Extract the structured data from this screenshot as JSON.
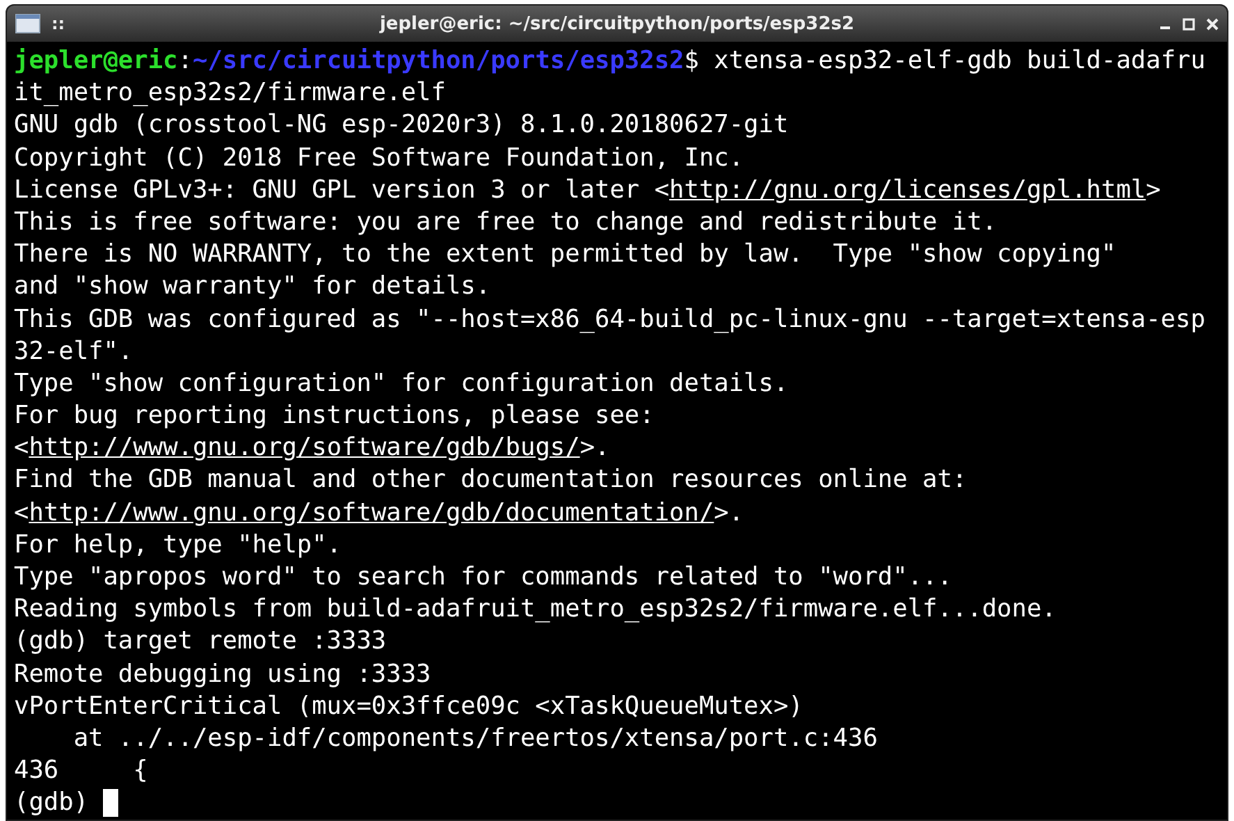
{
  "window": {
    "title": "jepler@eric: ~/src/circuitpython/ports/esp32s2",
    "menu_glyph": "::"
  },
  "terminal": {
    "lines": [
      {
        "segments": [
          {
            "kind": "user",
            "text": "jepler@eric"
          },
          {
            "kind": "text",
            "text": ":"
          },
          {
            "kind": "path",
            "text": "~/src/circuitpython/ports/esp32s2"
          },
          {
            "kind": "text",
            "text": "$ xtensa-esp32-elf-gdb build-adafru"
          }
        ]
      },
      {
        "segments": [
          {
            "kind": "text",
            "text": "it_metro_esp32s2/firmware.elf"
          }
        ]
      },
      {
        "segments": [
          {
            "kind": "text",
            "text": "GNU gdb (crosstool-NG esp-2020r3) 8.1.0.20180627-git"
          }
        ]
      },
      {
        "segments": [
          {
            "kind": "text",
            "text": "Copyright (C) 2018 Free Software Foundation, Inc."
          }
        ]
      },
      {
        "segments": [
          {
            "kind": "text",
            "text": "License GPLv3+: GNU GPL version 3 or later <"
          },
          {
            "kind": "link",
            "text": "http://gnu.org/licenses/gpl.html"
          },
          {
            "kind": "text",
            "text": ">"
          }
        ]
      },
      {
        "segments": [
          {
            "kind": "text",
            "text": "This is free software: you are free to change and redistribute it."
          }
        ]
      },
      {
        "segments": [
          {
            "kind": "text",
            "text": "There is NO WARRANTY, to the extent permitted by law.  Type \"show copying\""
          }
        ]
      },
      {
        "segments": [
          {
            "kind": "text",
            "text": "and \"show warranty\" for details."
          }
        ]
      },
      {
        "segments": [
          {
            "kind": "text",
            "text": "This GDB was configured as \"--host=x86_64-build_pc-linux-gnu --target=xtensa-esp"
          }
        ]
      },
      {
        "segments": [
          {
            "kind": "text",
            "text": "32-elf\"."
          }
        ]
      },
      {
        "segments": [
          {
            "kind": "text",
            "text": "Type \"show configuration\" for configuration details."
          }
        ]
      },
      {
        "segments": [
          {
            "kind": "text",
            "text": "For bug reporting instructions, please see:"
          }
        ]
      },
      {
        "segments": [
          {
            "kind": "text",
            "text": "<"
          },
          {
            "kind": "link",
            "text": "http://www.gnu.org/software/gdb/bugs/"
          },
          {
            "kind": "text",
            "text": ">."
          }
        ]
      },
      {
        "segments": [
          {
            "kind": "text",
            "text": "Find the GDB manual and other documentation resources online at:"
          }
        ]
      },
      {
        "segments": [
          {
            "kind": "text",
            "text": "<"
          },
          {
            "kind": "link",
            "text": "http://www.gnu.org/software/gdb/documentation/"
          },
          {
            "kind": "text",
            "text": ">."
          }
        ]
      },
      {
        "segments": [
          {
            "kind": "text",
            "text": "For help, type \"help\"."
          }
        ]
      },
      {
        "segments": [
          {
            "kind": "text",
            "text": "Type \"apropos word\" to search for commands related to \"word\"..."
          }
        ]
      },
      {
        "segments": [
          {
            "kind": "text",
            "text": "Reading symbols from build-adafruit_metro_esp32s2/firmware.elf...done."
          }
        ]
      },
      {
        "segments": [
          {
            "kind": "text",
            "text": "(gdb) target remote :3333"
          }
        ]
      },
      {
        "segments": [
          {
            "kind": "text",
            "text": "Remote debugging using :3333"
          }
        ]
      },
      {
        "segments": [
          {
            "kind": "text",
            "text": "vPortEnterCritical (mux=0x3ffce09c <xTaskQueueMutex>)"
          }
        ]
      },
      {
        "segments": [
          {
            "kind": "text",
            "text": "    at ../../esp-idf/components/freertos/xtensa/port.c:436"
          }
        ]
      },
      {
        "segments": [
          {
            "kind": "text",
            "text": "436     {"
          }
        ]
      },
      {
        "segments": [
          {
            "kind": "text",
            "text": "(gdb) "
          }
        ],
        "cursor": true
      }
    ]
  }
}
